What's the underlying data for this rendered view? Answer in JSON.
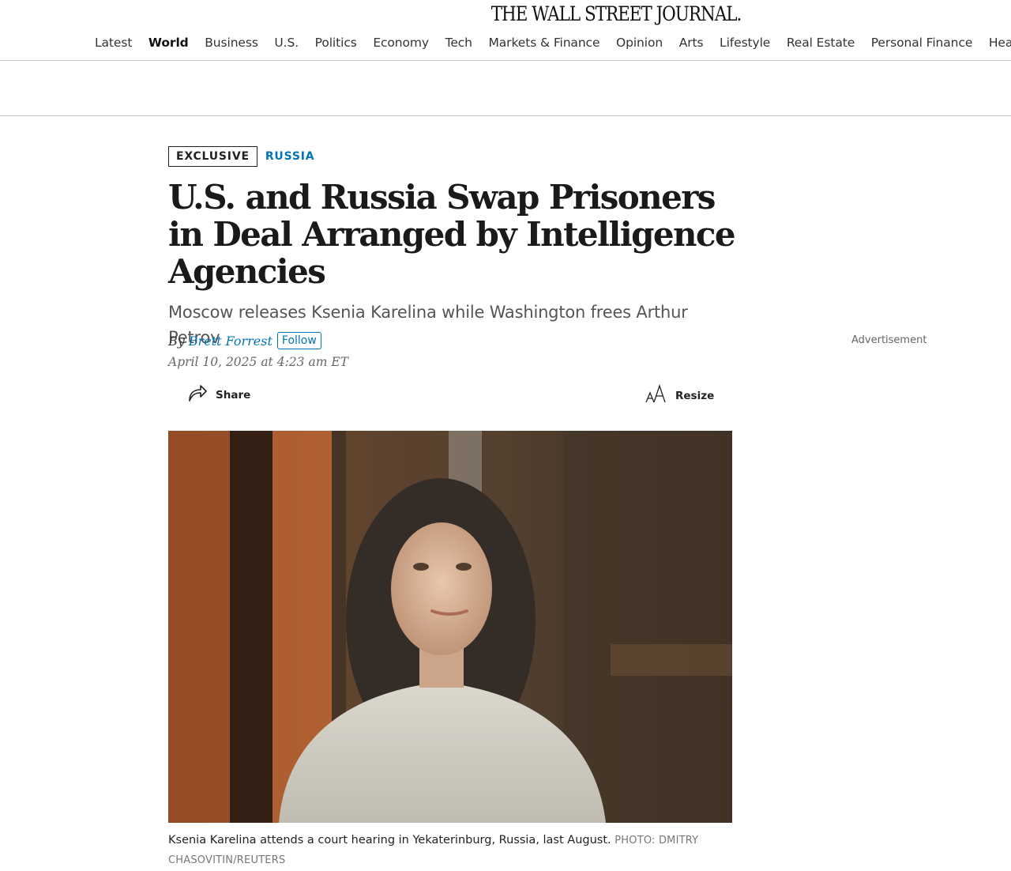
{
  "masthead": {
    "logo_text": "THE WALL STREET JOURNAL."
  },
  "nav": {
    "items": [
      {
        "label": "Latest"
      },
      {
        "label": "World",
        "active": true
      },
      {
        "label": "Business"
      },
      {
        "label": "U.S."
      },
      {
        "label": "Politics"
      },
      {
        "label": "Economy"
      },
      {
        "label": "Tech"
      },
      {
        "label": "Markets & Finance"
      },
      {
        "label": "Opinion"
      },
      {
        "label": "Arts"
      },
      {
        "label": "Lifestyle"
      },
      {
        "label": "Real Estate"
      },
      {
        "label": "Personal Finance"
      },
      {
        "label": "Health"
      }
    ]
  },
  "article": {
    "flag": "EXCLUSIVE",
    "section": "RUSSIA",
    "headline": "U.S. and Russia Swap Prisoners in Deal Arranged by Intelligence Agencies",
    "dek": "Moscow releases Ksenia Karelina while Washington frees Arthur Petrov",
    "by_prefix": "By",
    "author": "Brett Forrest",
    "follow_label": "Follow",
    "date": "April 10, 2025 at 4:23 am ET",
    "share_label": "Share",
    "resize_label": "Resize",
    "image_alt": "Ksenia Karelina attends a court hearing in Yekaterinburg, Russia, last August.",
    "caption": "Ksenia Karelina attends a court hearing in Yekaterinburg, Russia, last August.",
    "credit": "PHOTO: DMITRY CHASOVITIN/REUTERS"
  },
  "sidebar": {
    "ad_label": "Advertisement"
  },
  "colors": {
    "link": "#0274b6",
    "text": "#222222",
    "rule": "#c7c7c7"
  },
  "icons": {
    "share": "share-arrow-icon",
    "resize": "text-resize-icon"
  }
}
